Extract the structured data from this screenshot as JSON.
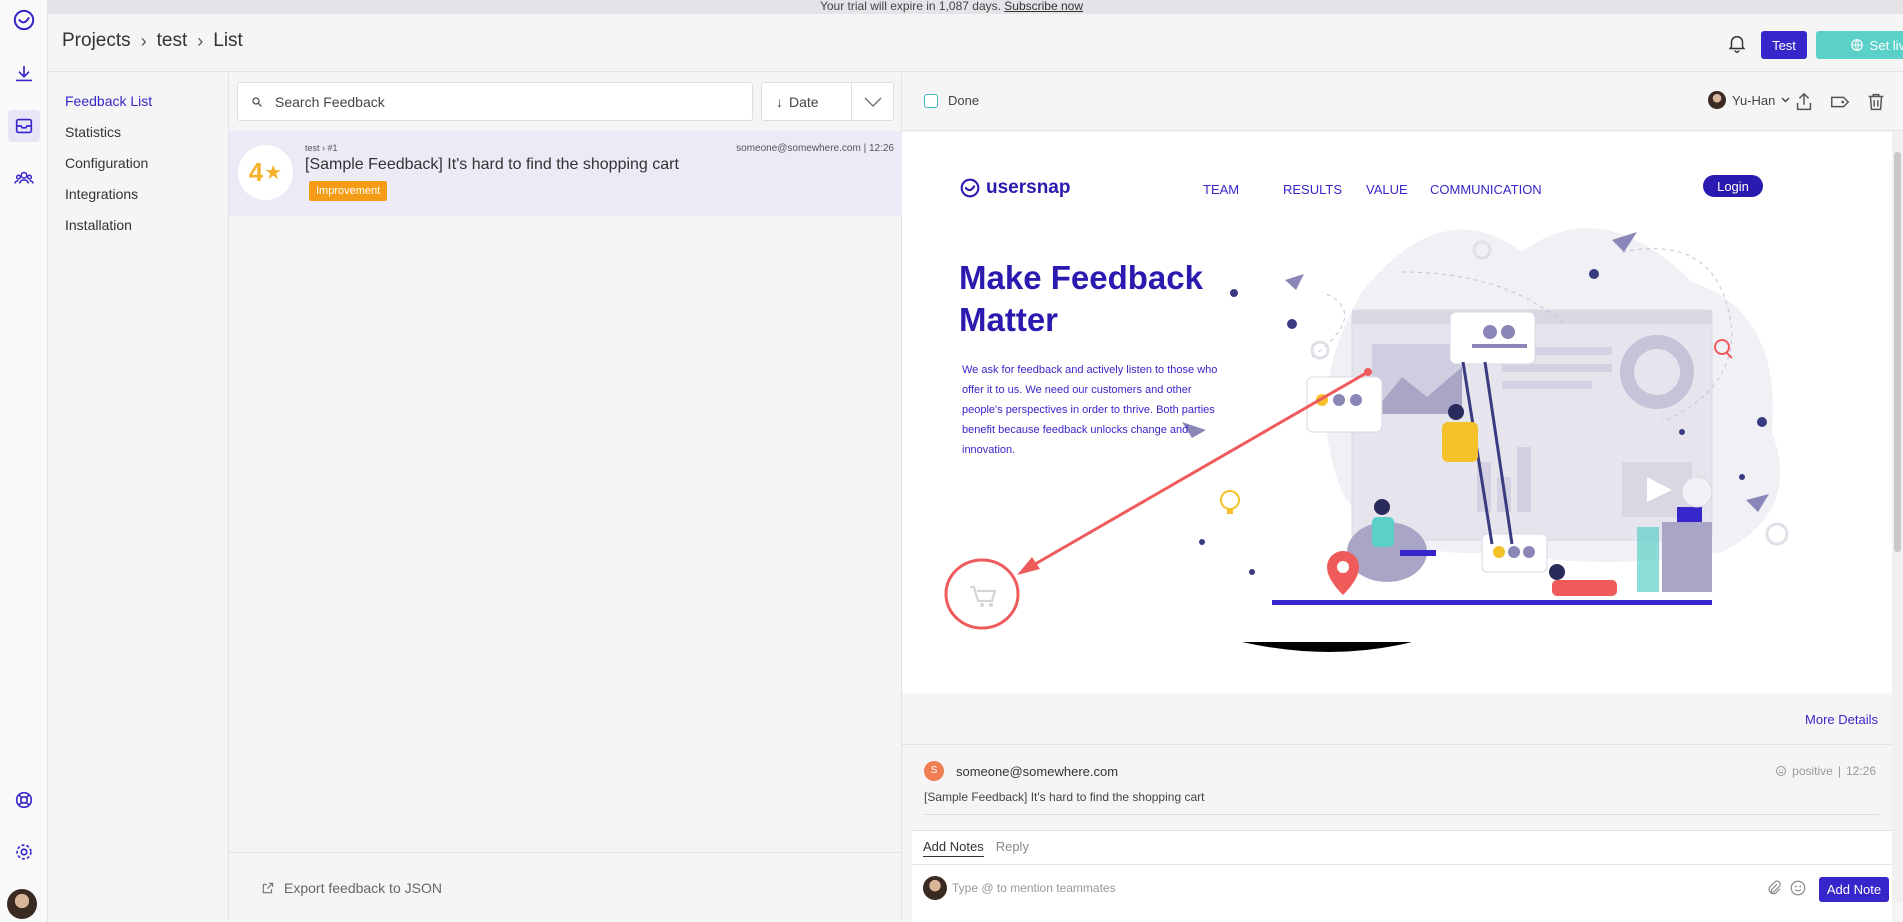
{
  "banner": {
    "text": "Your trial will expire in 1,087 days.",
    "link": "Subscribe now"
  },
  "header": {
    "breadcrumbs": [
      "Projects",
      "test",
      "List"
    ],
    "test_button": "Test",
    "set_live_button": "Set live"
  },
  "sidenav": {
    "items": [
      {
        "label": "Feedback List",
        "active": true
      },
      {
        "label": "Statistics"
      },
      {
        "label": "Configuration"
      },
      {
        "label": "Integrations"
      },
      {
        "label": "Installation"
      }
    ]
  },
  "list": {
    "search_placeholder": "Search Feedback",
    "sort_label": "Date",
    "export_label": "Export feedback to JSON",
    "items": [
      {
        "rating": "4",
        "meta": "test › #1",
        "email": "someone@somewhere.com",
        "time": "12:26",
        "title": "[Sample Feedback] It's hard to find the shopping cart",
        "tag": "Improvement"
      }
    ]
  },
  "detail": {
    "done_label": "Done",
    "assignee": "Yu-Han",
    "more_details": "More Details",
    "comment": {
      "avatar_letter": "S",
      "email": "someone@somewhere.com",
      "sentiment": "positive",
      "time": "12:26",
      "text": "[Sample Feedback] It's hard to find the shopping cart"
    },
    "notes": {
      "tab_notes": "Add Notes",
      "tab_reply": "Reply",
      "placeholder": "Type @ to mention teammates",
      "add_button": "Add Note"
    }
  },
  "captured_page": {
    "logo": "usersnap",
    "nav": [
      "TEAM",
      "RESULTS",
      "VALUE",
      "COMMUNICATION"
    ],
    "login": "Login",
    "headline_1": "Make Feedback",
    "headline_2": "Matter",
    "paragraph": "We ask for feedback and actively listen to those who offer it to us. We need our customers and other people's perspectives in order to thrive. Both parties benefit because feedback unlocks change and innovation."
  },
  "colors": {
    "primary": "#3726c9",
    "teal": "#5bd0c8",
    "tag_orange": "#f59c16",
    "rating_yellow": "#f4b12a",
    "annotation_red": "#ef5b5b"
  }
}
